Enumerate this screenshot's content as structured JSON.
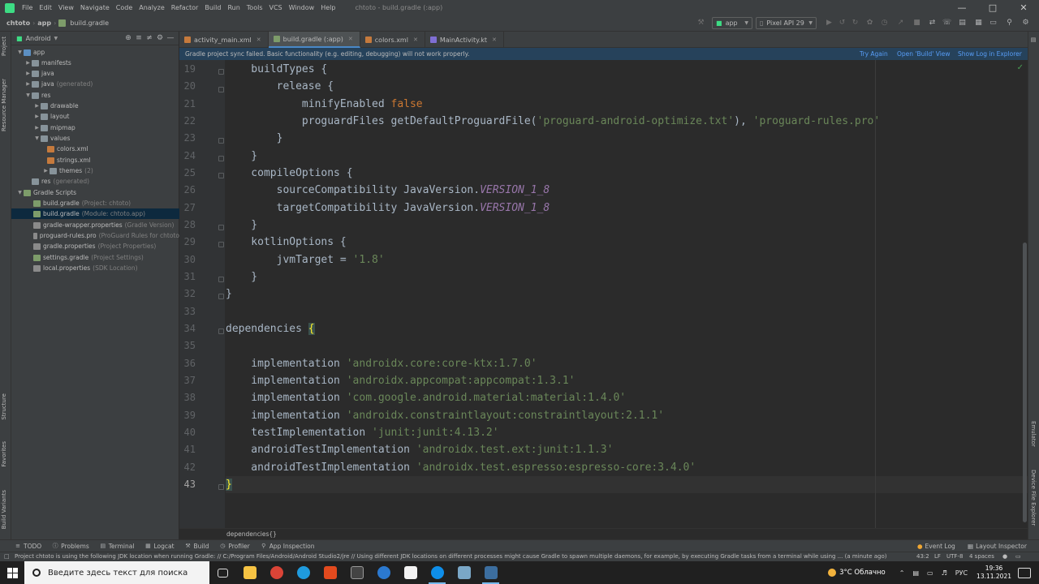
{
  "menu": {
    "items": [
      "File",
      "Edit",
      "View",
      "Navigate",
      "Code",
      "Analyze",
      "Refactor",
      "Build",
      "Run",
      "Tools",
      "VCS",
      "Window",
      "Help"
    ],
    "window_title": "chtoto - build.gradle (:app)"
  },
  "navbar": {
    "crumbs": [
      "chtoto",
      "app",
      "build.gradle"
    ],
    "run_config": "app",
    "device": "Pixel API 29"
  },
  "left_strip": {
    "project_tab": "Project",
    "resource_manager_tab": "Resource Manager",
    "structure_tab": "Structure",
    "favorites_tab": "Favorites",
    "build_variants_tab": "Build Variants"
  },
  "right_strip": {
    "emulator_tab": "Emulator",
    "device_explorer_tab": "Device File Explorer"
  },
  "project_panel": {
    "view_selector": "Android",
    "tree": [
      {
        "label": "app",
        "hint": ""
      },
      {
        "label": "manifests",
        "hint": ""
      },
      {
        "label": "java",
        "hint": ""
      },
      {
        "label": "java",
        "hint": "(generated)"
      },
      {
        "label": "res",
        "hint": ""
      },
      {
        "label": "drawable",
        "hint": ""
      },
      {
        "label": "layout",
        "hint": ""
      },
      {
        "label": "mipmap",
        "hint": ""
      },
      {
        "label": "values",
        "hint": ""
      },
      {
        "label": "colors.xml",
        "hint": ""
      },
      {
        "label": "strings.xml",
        "hint": ""
      },
      {
        "label": "themes",
        "hint": "(2)"
      },
      {
        "label": "res",
        "hint": "(generated)"
      },
      {
        "label": "Gradle Scripts",
        "hint": ""
      },
      {
        "label": "build.gradle",
        "hint": "(Project: chtoto)"
      },
      {
        "label": "build.gradle",
        "hint": "(Module: chtoto.app)"
      },
      {
        "label": "gradle-wrapper.properties",
        "hint": "(Gradle Version)"
      },
      {
        "label": "proguard-rules.pro",
        "hint": "(ProGuard Rules for chtoto"
      },
      {
        "label": "gradle.properties",
        "hint": "(Project Properties)"
      },
      {
        "label": "settings.gradle",
        "hint": "(Project Settings)"
      },
      {
        "label": "local.properties",
        "hint": "(SDK Location)"
      }
    ]
  },
  "editor_tabs": [
    "activity_main.xml",
    "build.gradle (:app)",
    "colors.xml",
    "MainActivity.kt"
  ],
  "notification": {
    "message": "Gradle project sync failed. Basic functionality (e.g. editing, debugging) will not work properly.",
    "try_again": "Try Again",
    "open_build_view": "Open 'Build' View",
    "show_log": "Show Log in Explorer"
  },
  "code": {
    "line_numbers": [
      "19",
      "20",
      "21",
      "22",
      "23",
      "24",
      "25",
      "26",
      "27",
      "28",
      "29",
      "30",
      "31",
      "32",
      "33",
      "34",
      "35",
      "36",
      "37",
      "38",
      "39",
      "40",
      "41",
      "42",
      "43"
    ],
    "l19": "    buildTypes {",
    "l20": "        release {",
    "l21a": "            minifyEnabled ",
    "l21b": "false",
    "l22a": "            proguardFiles getDefaultProguardFile(",
    "l22b": "'proguard-android-optimize.txt'",
    "l22c": "), ",
    "l22d": "'proguard-rules.pro'",
    "l23": "        }",
    "l24": "    }",
    "l25": "    compileOptions {",
    "l26a": "        sourceCompatibility JavaVersion.",
    "l26b": "VERSION_1_8",
    "l27a": "        targetCompatibility JavaVersion.",
    "l27b": "VERSION_1_8",
    "l28": "    }",
    "l29": "    kotlinOptions {",
    "l30a": "        jvmTarget = ",
    "l30b": "'1.8'",
    "l31": "    }",
    "l32": "}",
    "l33": "",
    "l34a": "dependencies ",
    "l34b": "{",
    "l35": "",
    "l36a": "    implementation ",
    "l36b": "'androidx.core:core-ktx:1.7.0'",
    "l37a": "    implementation ",
    "l37b": "'androidx.appcompat:appcompat:1.3.1'",
    "l38a": "    implementation ",
    "l38b": "'com.google.android.material:material:1.4.0'",
    "l39a": "    implementation ",
    "l39b": "'androidx.constraintlayout:constraintlayout:2.1.1'",
    "l40a": "    testImplementation ",
    "l40b": "'junit:junit:4.13.2'",
    "l41a": "    androidTestImplementation ",
    "l41b": "'androidx.test.ext:junit:1.1.3'",
    "l42a": "    androidTestImplementation ",
    "l42b": "'androidx.test.espresso:espresso-core:3.4.0'",
    "l43": "}"
  },
  "editor_breadcrumb": "dependencies{}",
  "tool_windows": {
    "todo": "TODO",
    "problems": "Problems",
    "terminal": "Terminal",
    "logcat": "Logcat",
    "build": "Build",
    "profiler": "Profiler",
    "app_inspection": "App Inspection",
    "event_log": "Event Log",
    "layout_inspector": "Layout Inspector"
  },
  "status_bar": {
    "message": "Project chtoto is using the following JDK location when running Gradle: // C:/Program Files/Android/Android Studio2/jre // Using different JDK locations on different processes might cause Gradle to spawn multiple daemons, for example, by executing Gradle tasks from a terminal while using ... (a minute ago)",
    "position": "43:2",
    "line_sep": "LF",
    "encoding": "UTF-8",
    "indent": "4 spaces"
  },
  "taskbar": {
    "search_placeholder": "Введите здесь текст для поиска",
    "weather": "3°C  Облачно",
    "lang": "РУС",
    "time": "19:36",
    "date": "13.11.2021"
  },
  "colors": {
    "keyword": "#cc7832",
    "string": "#6a8759",
    "constant": "#9876aa",
    "link": "#589df6",
    "selection": "#0d293e",
    "notification_bg": "#26425b"
  }
}
